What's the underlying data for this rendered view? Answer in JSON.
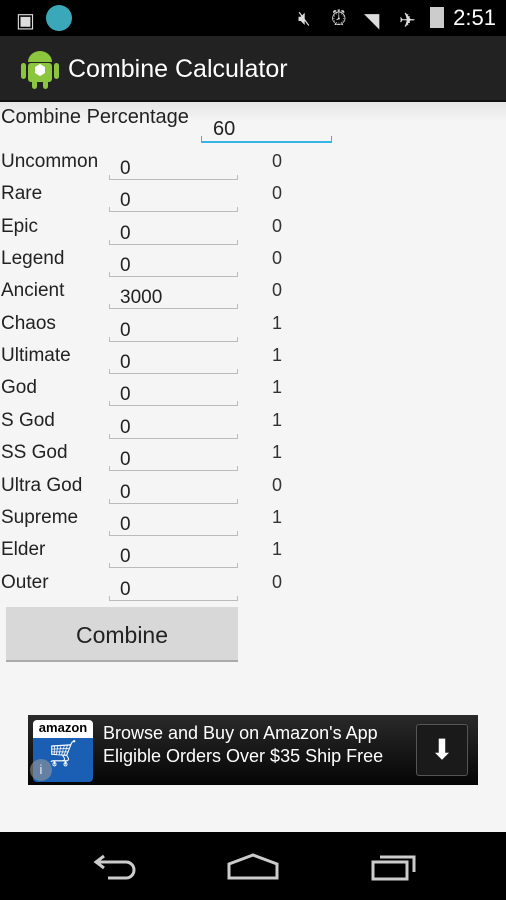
{
  "status_bar": {
    "time": "2:51",
    "icons": [
      "image-icon",
      "locket-icon",
      "mute-icon",
      "alarm-icon",
      "wifi-icon",
      "airplane-icon",
      "battery-icon"
    ]
  },
  "app_bar": {
    "title": "Combine Calculator",
    "icon": "android-app-icon"
  },
  "form": {
    "percentage_label": "Combine Percentage",
    "percentage_value": "60",
    "rows": [
      {
        "label": "Uncommon",
        "value": "0",
        "result": "0"
      },
      {
        "label": "Rare",
        "value": "0",
        "result": "0"
      },
      {
        "label": "Epic",
        "value": "0",
        "result": "0"
      },
      {
        "label": "Legend",
        "value": "0",
        "result": "0"
      },
      {
        "label": "Ancient",
        "value": "3000",
        "result": "0"
      },
      {
        "label": "Chaos",
        "value": "0",
        "result": "1"
      },
      {
        "label": "Ultimate",
        "value": "0",
        "result": "1"
      },
      {
        "label": "God",
        "value": "0",
        "result": "1"
      },
      {
        "label": "S God",
        "value": "0",
        "result": "1"
      },
      {
        "label": "SS God",
        "value": "0",
        "result": "1"
      },
      {
        "label": "Ultra God",
        "value": "0",
        "result": "0"
      },
      {
        "label": "Supreme",
        "value": "0",
        "result": "1"
      },
      {
        "label": "Elder",
        "value": "0",
        "result": "1"
      },
      {
        "label": "Outer",
        "value": "0",
        "result": "0"
      }
    ],
    "combine_label": "Combine"
  },
  "ad": {
    "brand": "amazon",
    "line1": "Browse and Buy on Amazon's App",
    "line2": "Eligible Orders Over $35 Ship Free",
    "accent": "#ff9900"
  },
  "colors": {
    "accent": "#33b5e5",
    "appbar": "#222222"
  }
}
